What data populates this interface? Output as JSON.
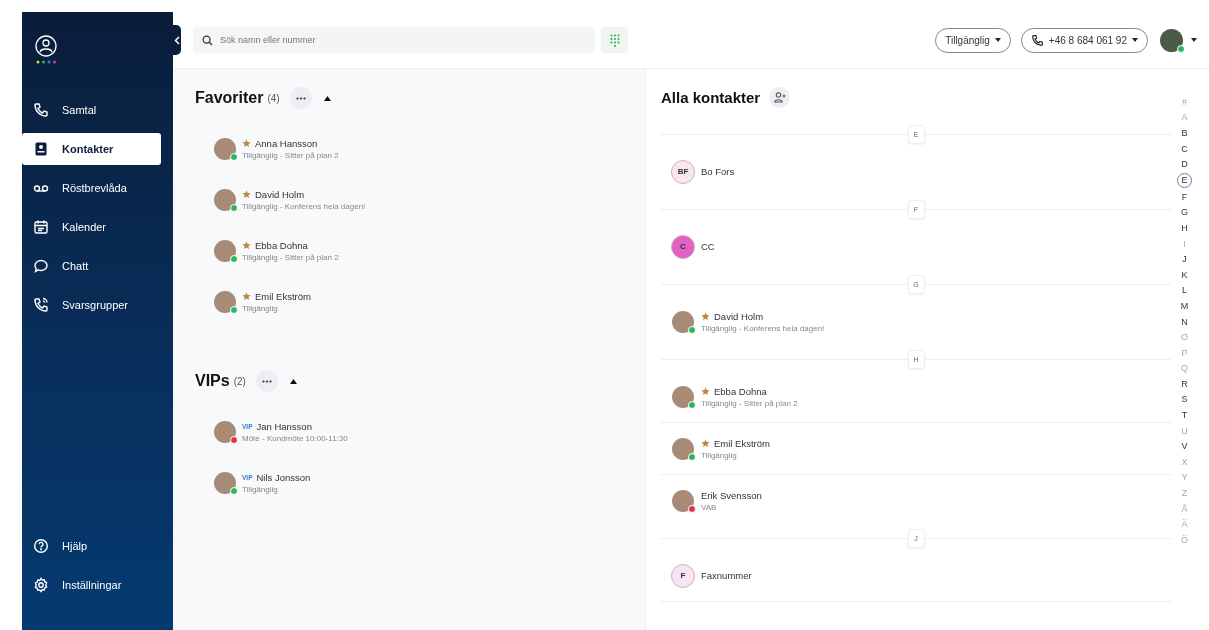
{
  "sidebar": {
    "nav": [
      {
        "label": "Samtal",
        "selected": false
      },
      {
        "label": "Kontakter",
        "selected": true
      },
      {
        "label": "Röstbrevlåda",
        "selected": false
      },
      {
        "label": "Kalender",
        "selected": false
      },
      {
        "label": "Chatt",
        "selected": false
      },
      {
        "label": "Svarsgrupper",
        "selected": false
      }
    ],
    "bottom": [
      {
        "label": "Hjälp"
      },
      {
        "label": "Inställningar"
      }
    ]
  },
  "topbar": {
    "search": {
      "placeholder": "Sök namn eller nummer"
    },
    "status_button": "Tillgänglig",
    "phone_button": "+46 8 684 061 92",
    "user_dot": {
      "color": "#2fb35a"
    }
  },
  "groups": [
    {
      "title": "Favoriter",
      "count": "(4)",
      "expanded": true,
      "contacts": [
        {
          "kind": "favorite",
          "name": "Anna Hansson",
          "status": "Tillgänglig - Sitter på plan 2",
          "dot": {
            "color": "#2fb35a"
          }
        },
        {
          "kind": "favorite",
          "name": "David Holm",
          "status": "Tillgänglig - Konferens hela dagen!",
          "dot": {
            "color": "#2fb35a"
          }
        },
        {
          "kind": "favorite",
          "name": "Ebba Dohna",
          "status": "Tillgänglig - Sitter på plan 2",
          "dot": {
            "color": "#2fb35a"
          }
        },
        {
          "kind": "favorite",
          "name": "Emil Ekström",
          "status": "Tillgänglig",
          "dot": {
            "color": "#2fb35a"
          }
        }
      ]
    },
    {
      "title": "VIPs",
      "count": "(2)",
      "expanded": true,
      "contacts": [
        {
          "kind": "vip",
          "tag": "VIP",
          "name": "Jan Hansson",
          "status": "Möte - Kundmöte 10:00-11:30",
          "dot": {
            "color": "#e0334a"
          }
        },
        {
          "kind": "vip",
          "tag": "VIP",
          "name": "Nils Jonsson",
          "status": "Tillgänglig",
          "dot": {
            "color": "#2fb35a"
          }
        }
      ]
    }
  ],
  "all_contacts": {
    "title": "Alla kontakter",
    "sections": [
      {
        "letter": "E",
        "contacts": [
          {
            "kind": "initials",
            "initials": "BF",
            "color": "#fbe6ec",
            "name": "Bo Fors",
            "favorite": false
          }
        ]
      },
      {
        "letter": "F",
        "contacts": [
          {
            "kind": "initials",
            "initials": "C",
            "color": "#e063c4",
            "name": "CC",
            "favorite": false
          }
        ]
      },
      {
        "letter": "G",
        "contacts": [
          {
            "kind": "photo",
            "name": "David Holm",
            "status": "Tillgänglig - Konferens hela dagen!",
            "dot": {
              "color": "#2fb35a"
            },
            "favorite": true
          }
        ]
      },
      {
        "letter": "H",
        "contacts": [
          {
            "kind": "photo",
            "name": "Ebba Dohna",
            "status": "Tillgänglig - Sitter på plan 2",
            "dot": {
              "color": "#2fb35a"
            },
            "favorite": true
          },
          {
            "kind": "photo",
            "name": "Emil Ekström",
            "status": "Tillgänglig",
            "dot": {
              "color": "#2fb35a"
            },
            "favorite": true
          },
          {
            "kind": "photo",
            "name": "Erik Svensson",
            "status": "VAB",
            "dot": {
              "color": "#e0334a"
            },
            "favorite": false
          }
        ]
      },
      {
        "letter": "J",
        "contacts": [
          {
            "kind": "initials",
            "initials": "F",
            "color": "#f8e4f4",
            "name": "Faxnummer",
            "favorite": false
          }
        ]
      }
    ]
  },
  "alphabet": [
    {
      "letter": "#",
      "enabled": false,
      "selected": false
    },
    {
      "letter": "A",
      "enabled": false,
      "selected": false
    },
    {
      "letter": "B",
      "enabled": true,
      "selected": false
    },
    {
      "letter": "C",
      "enabled": true,
      "selected": false
    },
    {
      "letter": "D",
      "enabled": true,
      "selected": false
    },
    {
      "letter": "E",
      "enabled": true,
      "selected": true
    },
    {
      "letter": "F",
      "enabled": true,
      "selected": false
    },
    {
      "letter": "G",
      "enabled": true,
      "selected": false
    },
    {
      "letter": "H",
      "enabled": true,
      "selected": false
    },
    {
      "letter": "I",
      "enabled": false,
      "selected": false
    },
    {
      "letter": "J",
      "enabled": true,
      "selected": false
    },
    {
      "letter": "K",
      "enabled": true,
      "selected": false
    },
    {
      "letter": "L",
      "enabled": true,
      "selected": false
    },
    {
      "letter": "M",
      "enabled": true,
      "selected": false
    },
    {
      "letter": "N",
      "enabled": true,
      "selected": false
    },
    {
      "letter": "O",
      "enabled": false,
      "selected": false
    },
    {
      "letter": "P",
      "enabled": false,
      "selected": false
    },
    {
      "letter": "Q",
      "enabled": false,
      "selected": false
    },
    {
      "letter": "R",
      "enabled": true,
      "selected": false
    },
    {
      "letter": "S",
      "enabled": true,
      "selected": false
    },
    {
      "letter": "T",
      "enabled": true,
      "selected": false
    },
    {
      "letter": "U",
      "enabled": false,
      "selected": false
    },
    {
      "letter": "V",
      "enabled": true,
      "selected": false
    },
    {
      "letter": "X",
      "enabled": false,
      "selected": false
    },
    {
      "letter": "Y",
      "enabled": false,
      "selected": false
    },
    {
      "letter": "Z",
      "enabled": false,
      "selected": false
    },
    {
      "letter": "Å",
      "enabled": false,
      "selected": false
    },
    {
      "letter": "Ä",
      "enabled": false,
      "selected": false
    },
    {
      "letter": "Ö",
      "enabled": false,
      "selected": false
    }
  ]
}
